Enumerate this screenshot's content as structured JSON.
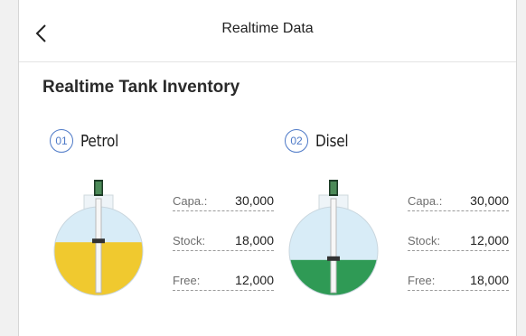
{
  "app_bar": {
    "title": "Realtime Data",
    "back_icon": "chevron-left-icon"
  },
  "section": {
    "title": "Realtime Tank Inventory"
  },
  "tanks": [
    {
      "number": "01",
      "name": "Petrol",
      "fill_color": "#f0c92f",
      "fill_level": 0.6,
      "stats": [
        {
          "label": "Capa.:",
          "value": "30,000"
        },
        {
          "label": "Stock:",
          "value": "18,000"
        },
        {
          "label": "Free:",
          "value": "12,000"
        }
      ]
    },
    {
      "number": "02",
      "name": "Disel",
      "fill_color": "#2f9a55",
      "fill_level": 0.4,
      "stats": [
        {
          "label": "Capa.:",
          "value": "30,000"
        },
        {
          "label": "Stock:",
          "value": "12,000"
        },
        {
          "label": "Free:",
          "value": "18,000"
        }
      ]
    }
  ],
  "colors": {
    "badge": "#4d79c7",
    "tank_empty": "#d8ecf7"
  }
}
